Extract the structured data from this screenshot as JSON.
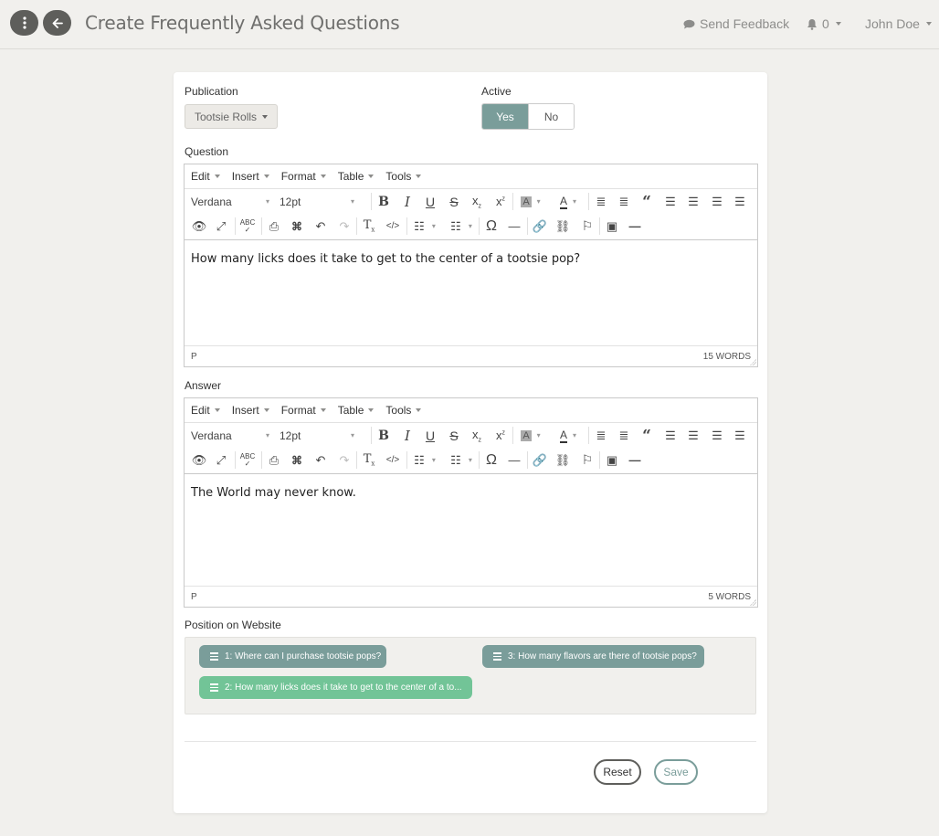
{
  "header": {
    "title": "Create Frequently Asked Questions",
    "feedback_label": "Send Feedback",
    "notification_count": "0",
    "user_name": "John Doe"
  },
  "form": {
    "publication": {
      "label": "Publication",
      "value": "Tootsie Rolls"
    },
    "active": {
      "label": "Active",
      "yes": "Yes",
      "no": "No",
      "selected": "Yes"
    },
    "question": {
      "label": "Question",
      "content": "How many licks does it take to get to the center of a tootsie pop?",
      "path": "P",
      "word_count": "15 WORDS"
    },
    "answer": {
      "label": "Answer",
      "content": "The World may never know.",
      "path": "P",
      "word_count": "5 WORDS"
    },
    "position": {
      "label": "Position on Website",
      "items": [
        {
          "text": "1: Where can I purchase tootsie pops?",
          "color": "#7a9d9a"
        },
        {
          "text": "2: How many licks does it take to get to the center of a to...",
          "color": "#72c497"
        },
        {
          "text": "3: How many flavors are there of tootsie pops?",
          "color": "#7a9d9a"
        }
      ]
    },
    "buttons": {
      "reset": "Reset",
      "save": "Save"
    }
  },
  "editor_toolbar": {
    "menus": [
      "Edit",
      "Insert",
      "Format",
      "Table",
      "Tools"
    ],
    "font_family": "Verdana",
    "font_size": "12pt",
    "icons_row1": [
      "bold-icon",
      "italic-icon",
      "underline-icon",
      "strikethrough-icon",
      "subscript-icon",
      "superscript-icon",
      "background-color-icon",
      "text-color-icon",
      "outdent-icon",
      "indent-icon",
      "blockquote-icon",
      "align-left-icon",
      "align-center-icon",
      "align-right-icon",
      "align-justify-icon"
    ],
    "icons_row2": [
      "preview-icon",
      "fullscreen-icon",
      "spellcheck-icon",
      "print-icon",
      "search-replace-icon",
      "undo-icon",
      "redo-icon",
      "clear-format-icon",
      "code-icon",
      "bullet-list-icon",
      "numbered-list-icon",
      "special-char-icon",
      "hr-icon",
      "link-icon",
      "unlink-icon",
      "anchor-icon",
      "image-icon",
      "horizontal-line-icon"
    ]
  },
  "colors": {
    "accent": "#7a9d9a",
    "highlight": "#72c497",
    "dark_button": "#5e5e5b",
    "page_bg": "#f1f0ed"
  }
}
